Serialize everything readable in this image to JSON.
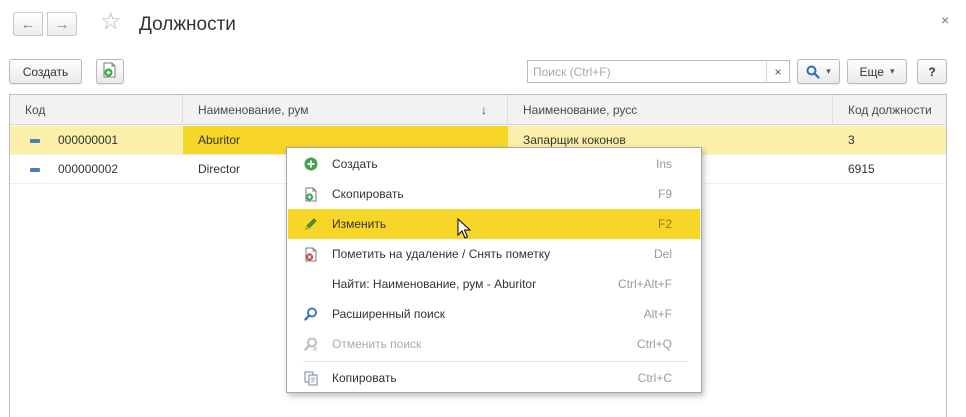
{
  "window": {
    "title": "Должности",
    "close_glyph": "×",
    "back_glyph": "←",
    "forward_glyph": "→",
    "star_glyph": "☆"
  },
  "toolbar": {
    "create_label": "Создать",
    "search_placeholder": "Поиск (Ctrl+F)",
    "search_value": "",
    "search_clear_glyph": "×",
    "more_label": "Еще",
    "help_label": "?",
    "dropdown_glyph": "▾"
  },
  "table": {
    "columns": [
      {
        "label": "Код"
      },
      {
        "label": "Наименование, рум",
        "sort": "↓"
      },
      {
        "label": "Наименование, русс"
      },
      {
        "label": "Код должности"
      }
    ],
    "rows": [
      {
        "code": "000000001",
        "name_rum": "Aburitor",
        "name_rus": "Запарщик коконов",
        "position_code": "3",
        "selected": true
      },
      {
        "code": "000000002",
        "name_rum": "Director",
        "name_rus": "",
        "position_code": "6915",
        "selected": false
      }
    ]
  },
  "context_menu": {
    "items": [
      {
        "label": "Создать",
        "shortcut": "Ins",
        "icon": "add-icon",
        "state": "normal"
      },
      {
        "label": "Скопировать",
        "shortcut": "F9",
        "icon": "copy-item-icon",
        "state": "normal"
      },
      {
        "label": "Изменить",
        "shortcut": "F2",
        "icon": "edit-pencil-icon",
        "state": "highlighted"
      },
      {
        "label": "Пометить на удаление / Снять пометку",
        "shortcut": "Del",
        "icon": "mark-delete-icon",
        "state": "normal"
      },
      {
        "label": "Найти: Наименование, рум - Aburitor",
        "shortcut": "Ctrl+Alt+F",
        "icon": "",
        "state": "normal"
      },
      {
        "label": "Расширенный поиск",
        "shortcut": "Alt+F",
        "icon": "advanced-search-icon",
        "state": "normal"
      },
      {
        "label": "Отменить поиск",
        "shortcut": "Ctrl+Q",
        "icon": "cancel-search-icon",
        "state": "disabled"
      },
      {
        "label": "Копировать",
        "shortcut": "Ctrl+C",
        "icon": "clipboard-copy-icon",
        "state": "normal"
      }
    ]
  },
  "colors": {
    "selection_row": "#fbf0a9",
    "highlight": "#f7d628",
    "add_icon": "#3aa84a",
    "delete_icon": "#d83a3a",
    "row_marker": "#4c7fb8"
  }
}
